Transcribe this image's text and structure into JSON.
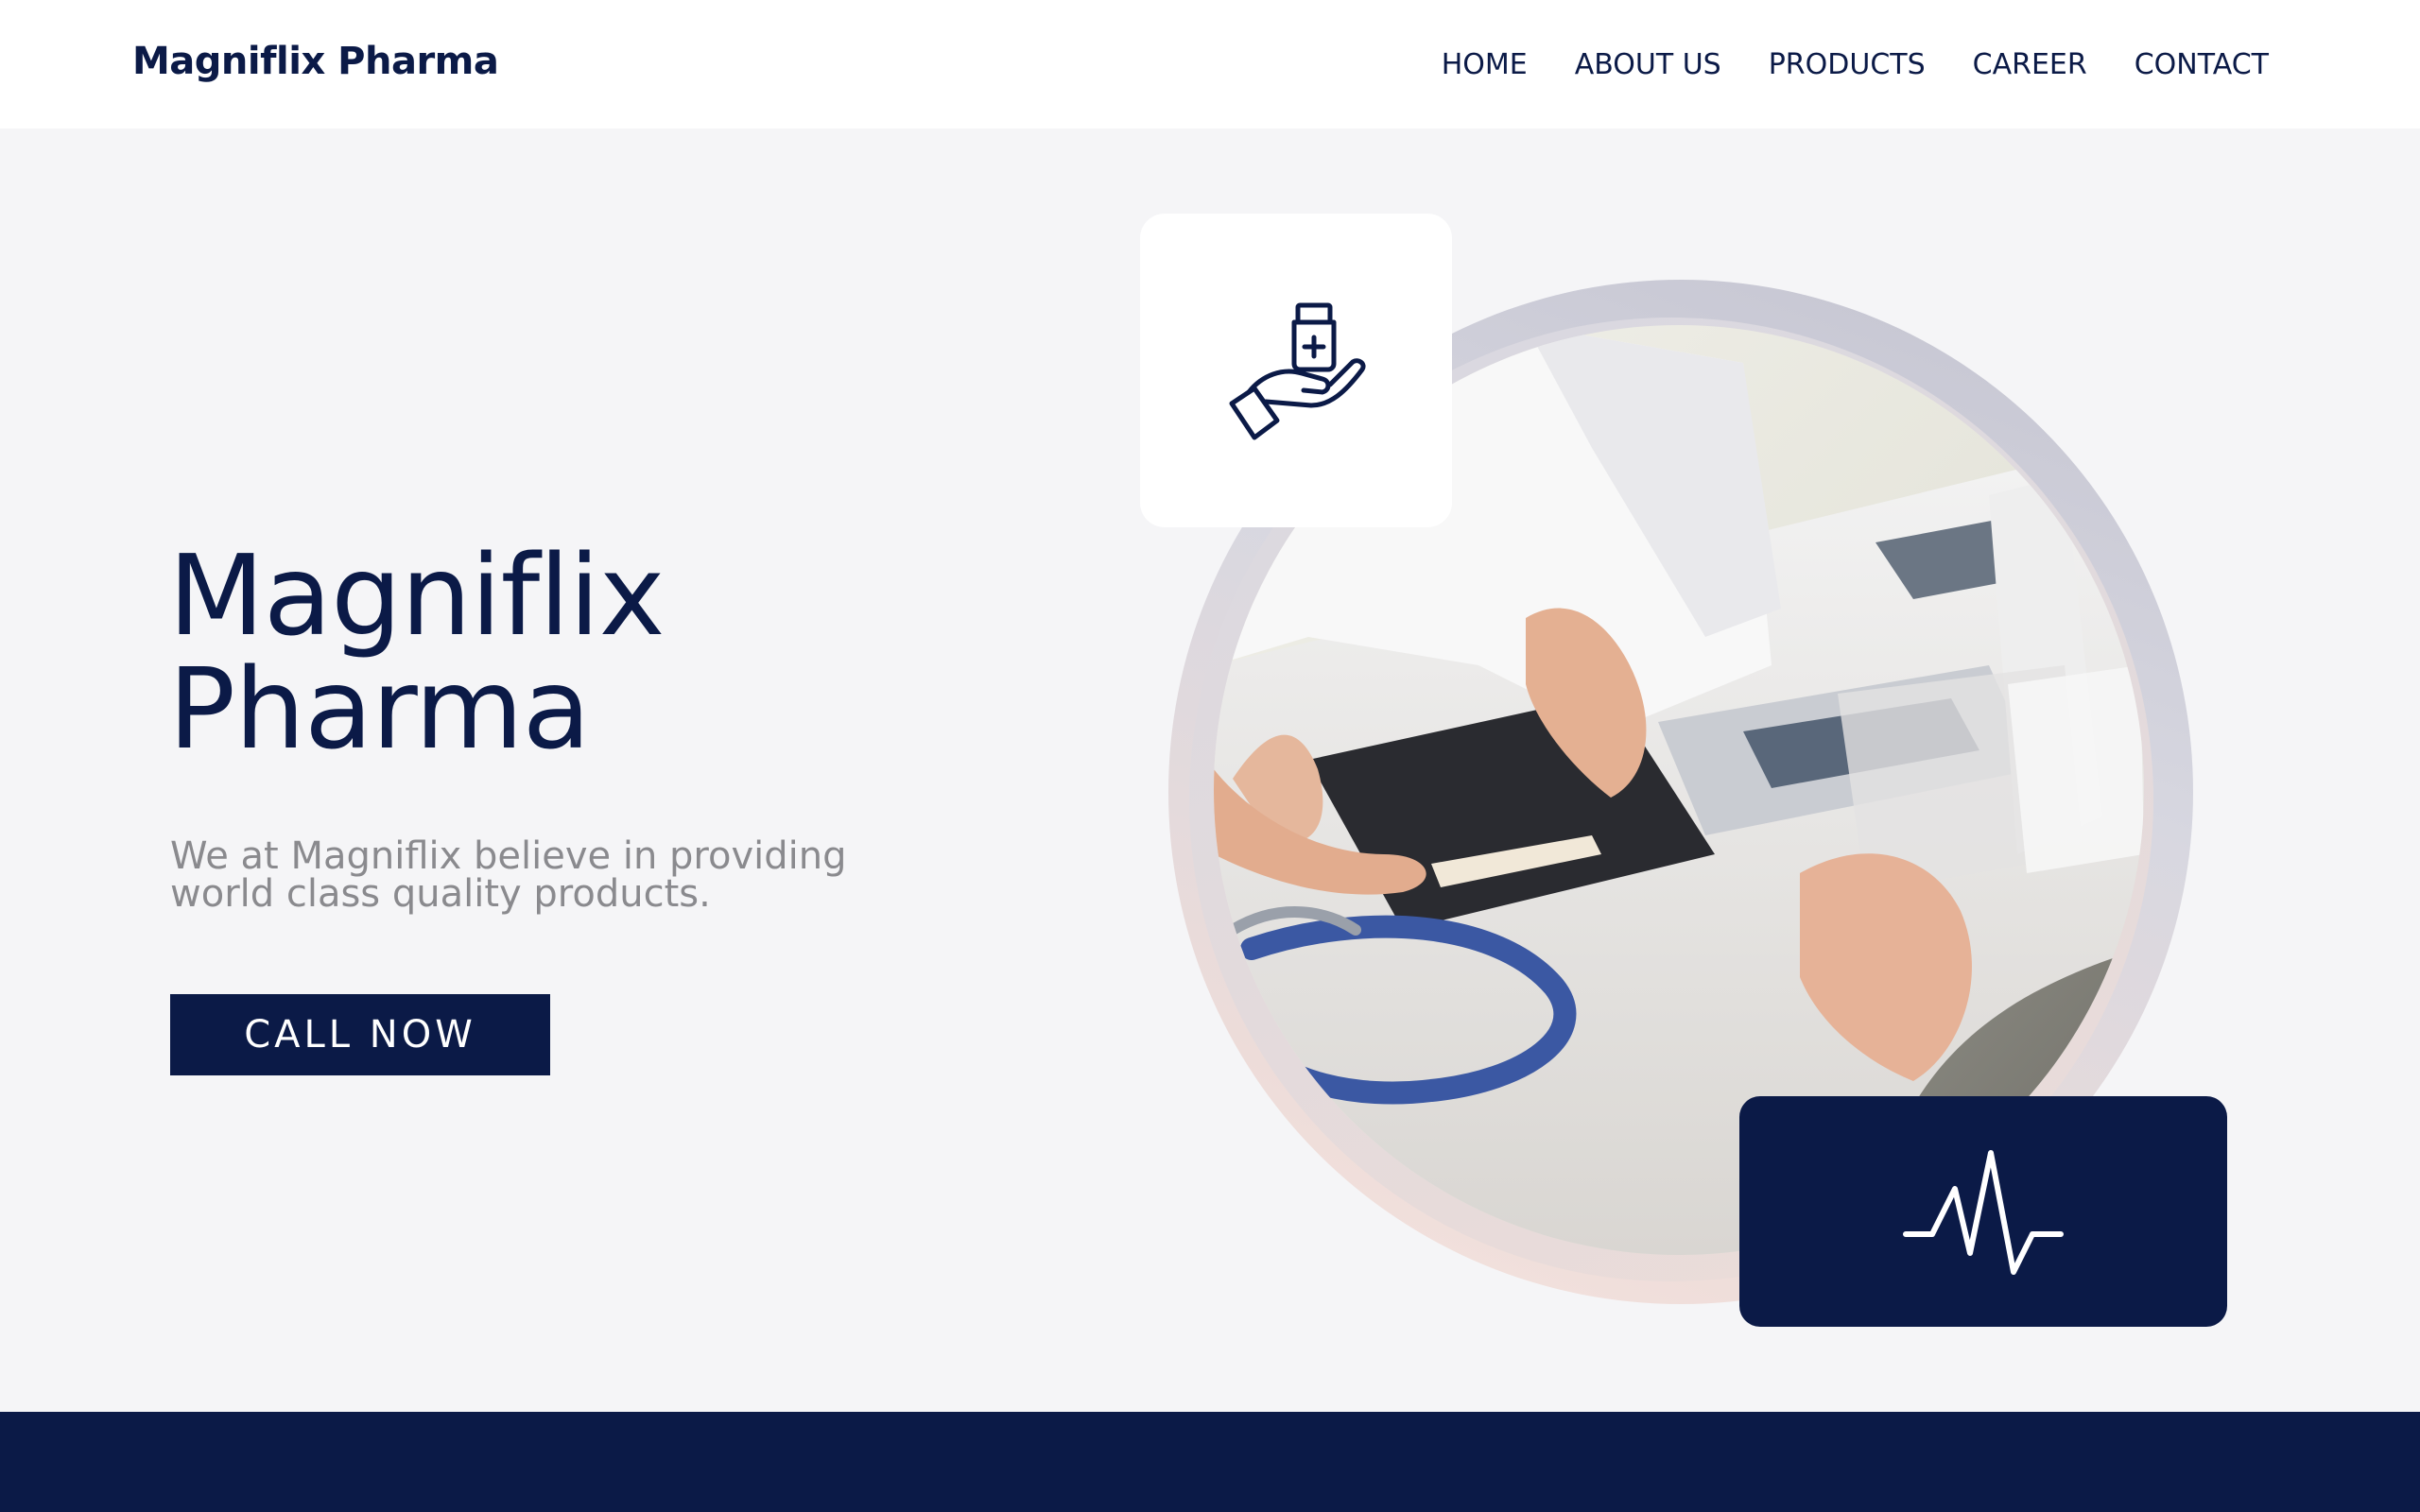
{
  "header": {
    "brand": "Magniflix Pharma",
    "nav": [
      {
        "label": "HOME"
      },
      {
        "label": "ABOUT US"
      },
      {
        "label": "PRODUCTS"
      },
      {
        "label": "CAREER"
      },
      {
        "label": "CONTACT"
      }
    ]
  },
  "hero": {
    "title_line1": "Magniflix",
    "title_line2": "Pharma",
    "subtitle_line1": "We at Magniflix believe in providing",
    "subtitle_line2": "world class quality products.",
    "cta_label": "CALL NOW"
  },
  "media": {
    "photo_subject": "doctor-consultation-photo",
    "top_card_icon": "hand-holding-medicine-icon",
    "bottom_card_icon": "heartbeat-pulse-icon"
  },
  "colors": {
    "navy": "#0b1a47",
    "background": "#f5f5f7",
    "subtitle_gray": "#8a8a8e",
    "white": "#ffffff"
  }
}
